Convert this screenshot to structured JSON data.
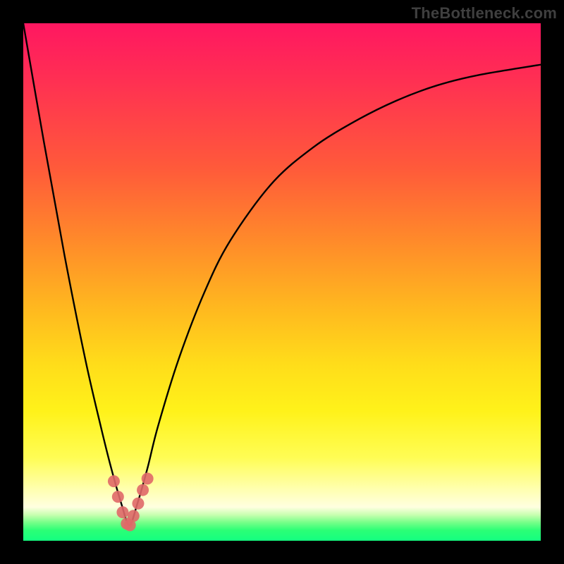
{
  "watermark": "TheBottleneck.com",
  "colors": {
    "frame": "#000000",
    "curve": "#000000",
    "marker": "#e06868",
    "gradient_top": "#ff1761",
    "gradient_bottom": "#14ff80"
  },
  "chart_data": {
    "type": "line",
    "title": "",
    "xlabel": "",
    "ylabel": "",
    "xlim": [
      0,
      100
    ],
    "ylim": [
      0,
      100
    ],
    "series": [
      {
        "name": "bottleneck-curve",
        "x": [
          0,
          4,
          8,
          12,
          15,
          17,
          19,
          20.5,
          22,
          24,
          26,
          30,
          35,
          40,
          48,
          56,
          64,
          72,
          80,
          88,
          100
        ],
        "y": [
          100,
          77,
          55,
          35,
          22,
          14,
          7,
          3,
          7,
          14,
          22,
          35,
          48,
          58,
          69,
          76,
          81,
          85,
          88,
          90,
          92
        ]
      }
    ],
    "markers": {
      "name": "highlight-dots",
      "x": [
        17.5,
        18.3,
        19.2,
        20.0,
        20.6,
        21.3,
        22.2,
        23.1,
        24.0
      ],
      "y": [
        11.5,
        8.5,
        5.5,
        3.3,
        3.0,
        4.8,
        7.2,
        9.8,
        12.0
      ]
    }
  }
}
